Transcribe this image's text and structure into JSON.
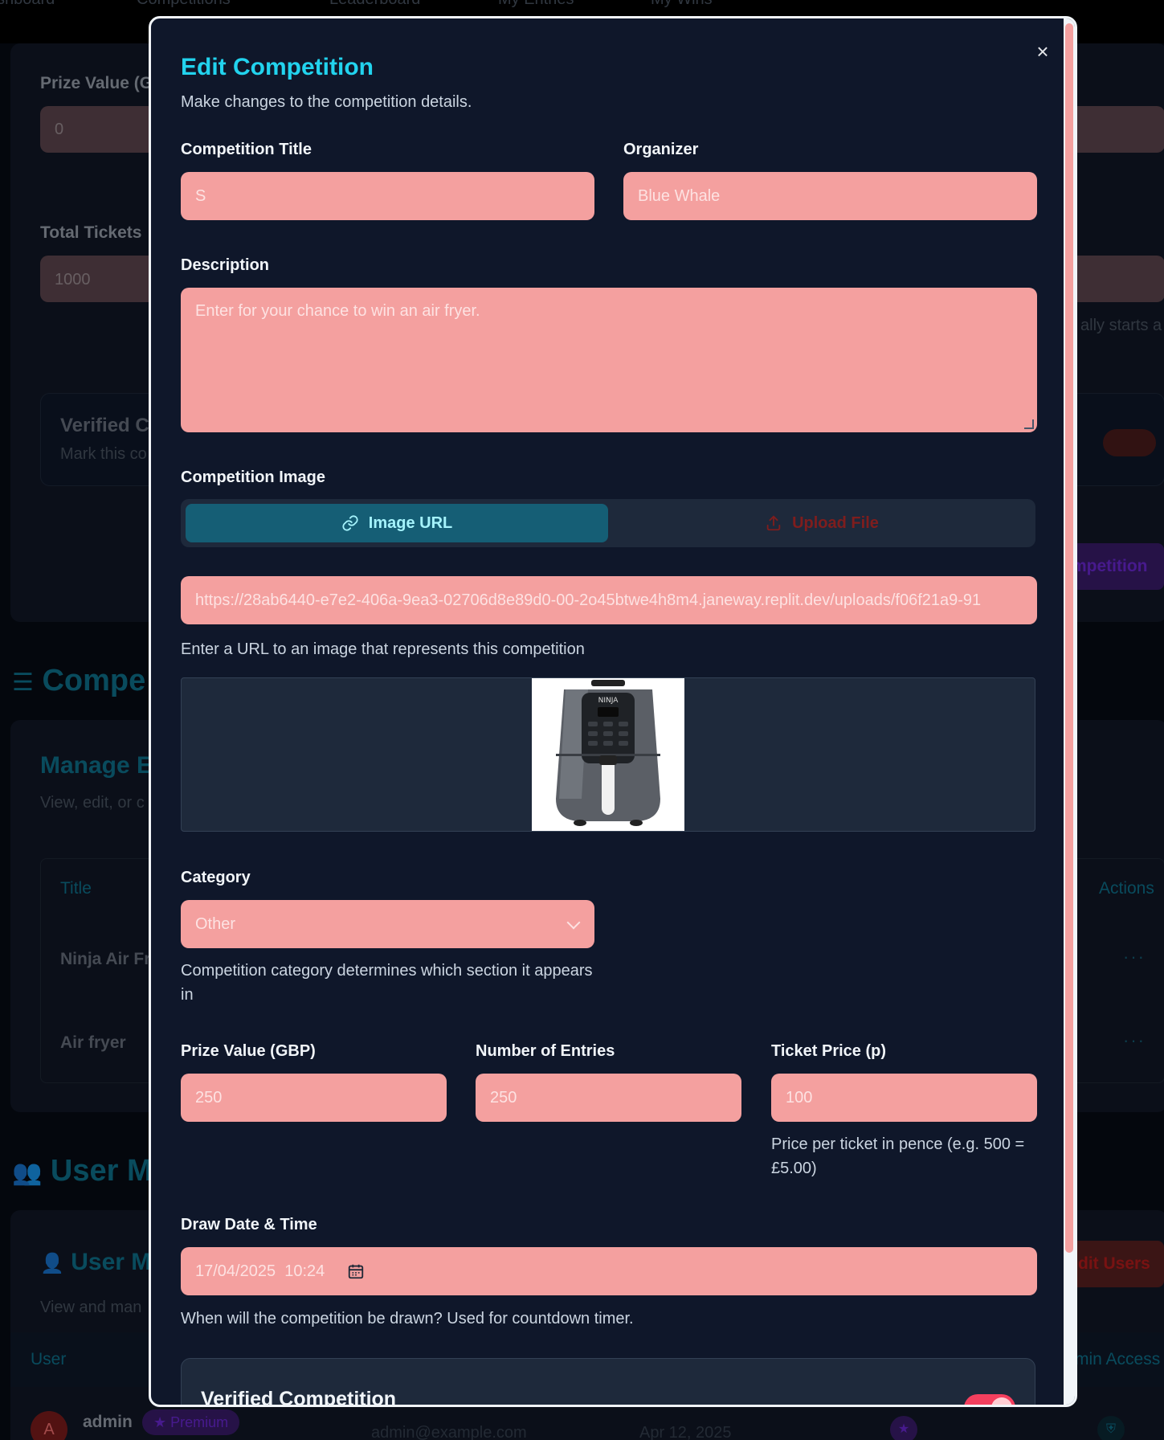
{
  "background": {
    "nav": [
      "shboard",
      "Competitions",
      "Leaderboard",
      "My Entries",
      "My Wins"
    ],
    "prize_value_label": "Prize Value (G",
    "prize_value_input": "0",
    "total_tickets_label": "Total Tickets",
    "total_tickets_input": "1000",
    "auto_starts": "ally starts a",
    "verified_title": "Verified Co",
    "verified_sub": "Mark this co",
    "create_btn": "mpetition",
    "competitions_heading": "Compe",
    "manage_title": "Manage E",
    "manage_sub": "View, edit, or c",
    "th_title": "Title",
    "th_actions": "Actions",
    "row1": "Ninja Air Fr",
    "row2": "Air fryer",
    "users_heading": "User M",
    "user_mgmt_title": "User M",
    "user_mgmt_sub": "View and man",
    "th_user": "User",
    "th_admin": "min Access",
    "edit_users": "dit Users",
    "user_name": "admin",
    "user_badge": "Premium",
    "user_email": "admin@example.com",
    "user_date": "Apr 12, 2025",
    "avatar_letter": "A"
  },
  "modal": {
    "title": "Edit Competition",
    "description": "Make changes to the competition details.",
    "close_glyph": "×",
    "fields": {
      "title_label": "Competition Title",
      "title_value": "S",
      "organizer_label": "Organizer",
      "organizer_value": "Blue Whale",
      "description_label": "Description",
      "description_value": "Enter for your chance to win an air fryer.",
      "image_label": "Competition Image",
      "tab_url": "Image URL",
      "tab_upload": "Upload File",
      "image_url": "https://28ab6440-e7e2-406a-9ea3-02706d8e89d0-00-2o45btwe4h8m4.janeway.replit.dev/uploads/f06f21a9-91",
      "image_help": "Enter a URL to an image that represents this competition",
      "category_label": "Category",
      "category_value": "Other",
      "category_help": "Competition category determines which section it appears in",
      "prize_label": "Prize Value (GBP)",
      "prize_value": "250",
      "entries_label": "Number of Entries",
      "entries_value": "250",
      "ticket_label": "Ticket Price (p)",
      "ticket_value": "100",
      "ticket_help": "Price per ticket in pence (e.g. 500 = £5.00)",
      "draw_label": "Draw Date & Time",
      "draw_value": "17/04/2025  10:24",
      "draw_help": "When will the competition be drawn? Used for countdown timer.",
      "verified_title": "Verified Competition"
    },
    "product_brand": "NINJA"
  },
  "colors": {
    "accent": "#22d3ee",
    "input_bg": "#f4a09f",
    "modal_bg": "#0f172a",
    "toggle_on": "#f43f5e"
  }
}
